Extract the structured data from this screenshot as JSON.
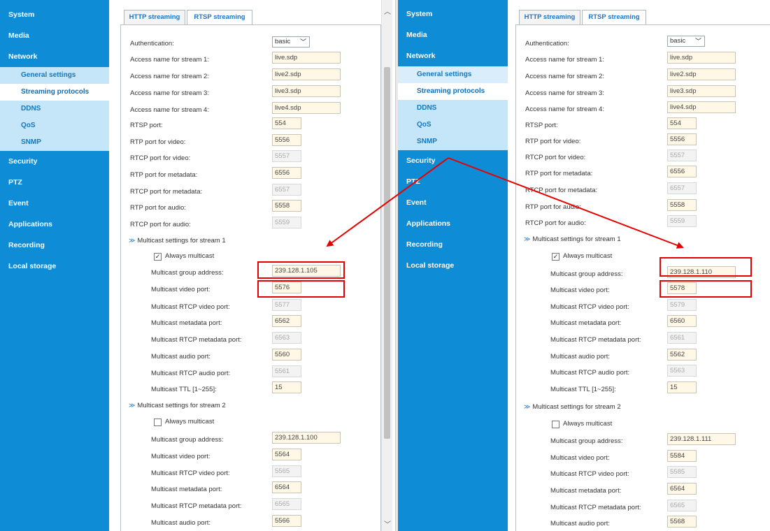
{
  "sidebar": {
    "items": [
      {
        "label": "System"
      },
      {
        "label": "Media"
      },
      {
        "label": "Network"
      },
      {
        "label": "General settings"
      },
      {
        "label": "Streaming protocols"
      },
      {
        "label": "DDNS"
      },
      {
        "label": "QoS"
      },
      {
        "label": "SNMP"
      },
      {
        "label": "Security"
      },
      {
        "label": "PTZ"
      },
      {
        "label": "Event"
      },
      {
        "label": "Applications"
      },
      {
        "label": "Recording"
      },
      {
        "label": "Local storage"
      }
    ]
  },
  "tabs": {
    "http": "HTTP streaming",
    "rtsp": "RTSP streaming"
  },
  "labels": {
    "auth": "Authentication:",
    "access1": "Access name for stream 1:",
    "access2": "Access name for stream 2:",
    "access3": "Access name for stream 3:",
    "access4": "Access name for stream 4:",
    "rtsp_port": "RTSP port:",
    "rtp_video": "RTP port for video:",
    "rtcp_video": "RTCP port for video:",
    "rtp_meta": "RTP port for metadata:",
    "rtcp_meta": "RTCP port for metadata:",
    "rtp_audio": "RTP port for audio:",
    "rtcp_audio": "RTCP port for audio:",
    "mc_s1": "Multicast settings for stream 1",
    "mc_s2": "Multicast settings for stream 2",
    "always": "Always multicast",
    "group": "Multicast group address:",
    "video": "Multicast video port:",
    "rtcp_v": "Multicast RTCP video port:",
    "meta": "Multicast metadata port:",
    "rtcp_m": "Multicast RTCP metadata port:",
    "audio": "Multicast audio port:",
    "rtcp_a": "Multicast RTCP audio port:",
    "ttl": "Multicast TTL [1~255]:"
  },
  "left": {
    "auth": "basic",
    "access1": "live.sdp",
    "access2": "live2.sdp",
    "access3": "live3.sdp",
    "access4": "live4.sdp",
    "rtsp_port": "554",
    "rtp_video": "5556",
    "rtcp_video": "5557",
    "rtp_meta": "6556",
    "rtcp_meta": "6557",
    "rtp_audio": "5558",
    "rtcp_audio": "5559",
    "s1": {
      "always": true,
      "group": "239.128.1.105",
      "video": "5576",
      "rtcp_v": "5577",
      "meta": "6562",
      "rtcp_m": "6563",
      "audio": "5560",
      "rtcp_a": "5561",
      "ttl": "15"
    },
    "s2": {
      "always": false,
      "group": "239.128.1.100",
      "video": "5564",
      "rtcp_v": "5565",
      "meta": "6564",
      "rtcp_m": "6565",
      "audio": "5566"
    }
  },
  "right": {
    "auth": "basic",
    "access1": "live.sdp",
    "access2": "live2.sdp",
    "access3": "live3.sdp",
    "access4": "live4.sdp",
    "rtsp_port": "554",
    "rtp_video": "5556",
    "rtcp_video": "5557",
    "rtp_meta": "6556",
    "rtcp_meta": "6557",
    "rtp_audio": "5558",
    "rtcp_audio": "5559",
    "s1": {
      "always": true,
      "group": "239.128.1.110",
      "video": "5578",
      "rtcp_v": "5579",
      "meta": "6560",
      "rtcp_m": "6561",
      "audio": "5562",
      "rtcp_a": "5563",
      "ttl": "15"
    },
    "s2": {
      "always": false,
      "group": "239.128.1.111",
      "video": "5584",
      "rtcp_v": "5585",
      "meta": "6564",
      "rtcp_m": "6565",
      "audio": "5568"
    }
  },
  "icons": {
    "scroll_up": "chevron-up-icon",
    "scroll_down": "chevron-down-icon",
    "collapse": "double-chevron-down-icon"
  },
  "colors": {
    "sidebar": "#0e8cd6",
    "highlight": "#e60000"
  }
}
